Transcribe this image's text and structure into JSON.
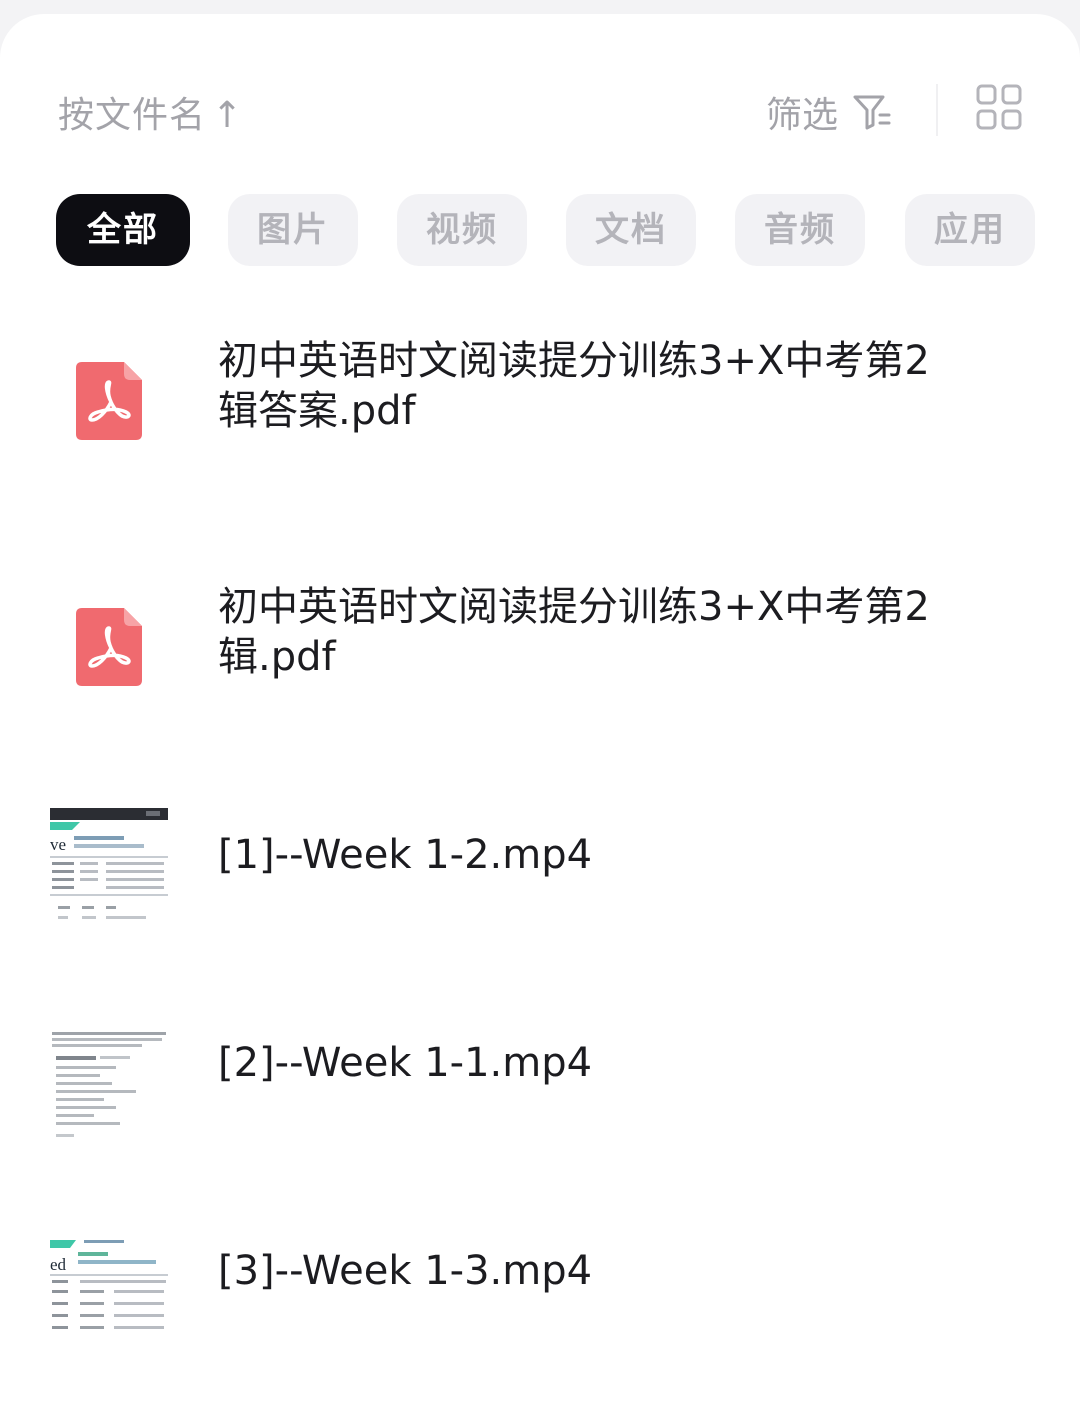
{
  "toolbar": {
    "sort_label": "按文件名",
    "sort_arrow": "↑",
    "filter_label": "筛选",
    "filter_icon": "filter-icon",
    "view_icon": "grid-view-icon"
  },
  "tabs": [
    {
      "label": "全部",
      "active": true
    },
    {
      "label": "图片",
      "active": false
    },
    {
      "label": "视频",
      "active": false
    },
    {
      "label": "文档",
      "active": false
    },
    {
      "label": "音频",
      "active": false
    },
    {
      "label": "应用",
      "active": false
    }
  ],
  "files": [
    {
      "name": "初中英语时文阅读提分训练3+X中考第2辑答案.pdf",
      "type": "pdf",
      "icon": "pdf-icon"
    },
    {
      "name": "初中英语时文阅读提分训练3+X中考第2辑.pdf",
      "type": "pdf",
      "icon": "pdf-icon"
    },
    {
      "name": "[1]--Week 1-2.mp4",
      "type": "video",
      "icon": "video-thumbnail"
    },
    {
      "name": "[2]--Week 1-1.mp4",
      "type": "video",
      "icon": "video-thumbnail"
    },
    {
      "name": "[3]--Week 1-3.mp4",
      "type": "video",
      "icon": "video-thumbnail"
    }
  ],
  "colors": {
    "active_tab_bg": "#0d0d12",
    "inactive_tab_bg": "#f2f2f5",
    "pdf_red": "#f06a6f",
    "muted_text": "#a3a3a9"
  }
}
